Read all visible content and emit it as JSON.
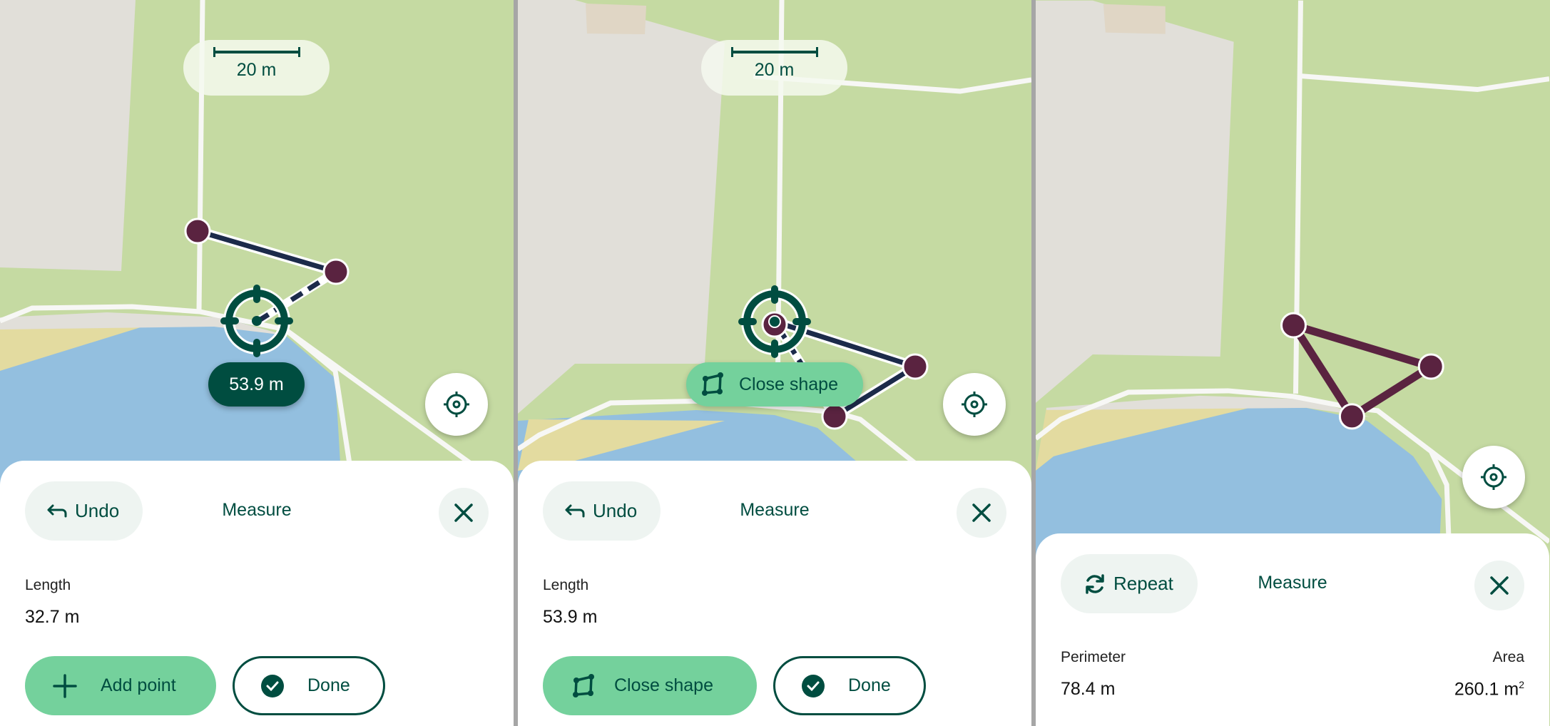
{
  "colors": {
    "brand_dark": "#004d40",
    "brand_light": "#74d19c",
    "vertex": "#5a2340",
    "line": "#1c2b4a",
    "park": "#c5daa2",
    "building": "#e1dfd9",
    "water": "#93bfdf",
    "sand": "#e3dba0"
  },
  "screens": [
    {
      "id": "adding-points",
      "scale_label": "20 m",
      "tooltip_distance": "53.9 m",
      "sheet": {
        "left_button": {
          "label": "Undo",
          "icon": "undo-arrow-icon"
        },
        "title": "Measure",
        "close_icon": "close-icon",
        "metrics": [
          {
            "label": "Length",
            "value": "32.7 m"
          }
        ],
        "primary_button": {
          "label": "Add point",
          "icon": "plus-icon"
        },
        "secondary_button": {
          "label": "Done",
          "icon": "check-circle-icon"
        }
      }
    },
    {
      "id": "close-shape-prompt",
      "scale_label": "20 m",
      "map_chip": {
        "label": "Close shape",
        "icon": "polygon-icon"
      },
      "sheet": {
        "left_button": {
          "label": "Undo",
          "icon": "undo-arrow-icon"
        },
        "title": "Measure",
        "close_icon": "close-icon",
        "metrics": [
          {
            "label": "Length",
            "value": "53.9 m"
          }
        ],
        "primary_button": {
          "label": "Close shape",
          "icon": "polygon-icon"
        },
        "secondary_button": {
          "label": "Done",
          "icon": "check-circle-icon"
        }
      }
    },
    {
      "id": "shape-closed",
      "sheet": {
        "left_button": {
          "label": "Repeat",
          "icon": "repeat-icon"
        },
        "title": "Measure",
        "close_icon": "close-icon",
        "metrics": [
          {
            "label": "Perimeter",
            "value": "78.4 m"
          },
          {
            "label": "Area",
            "value": "260.1 m",
            "unit_sup": "2"
          }
        ]
      }
    }
  ]
}
